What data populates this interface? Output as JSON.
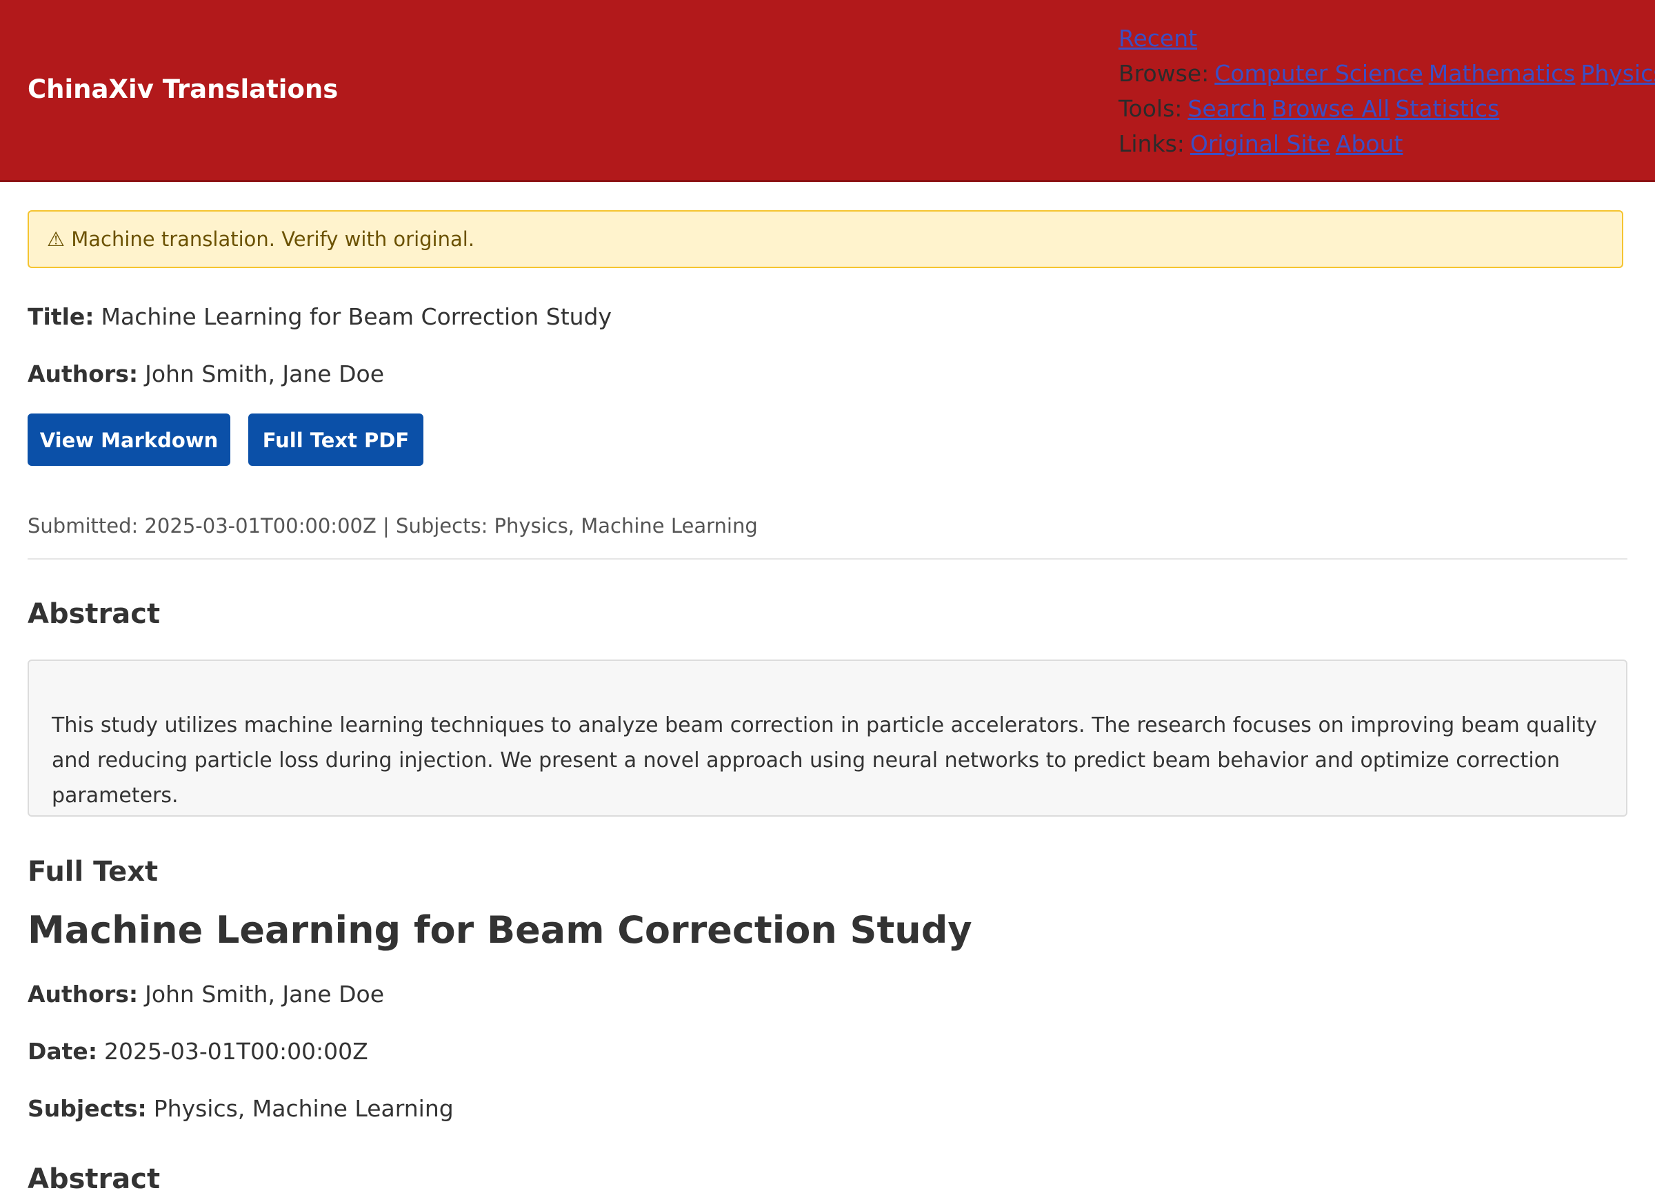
{
  "header": {
    "brand": "ChinaXiv Translations",
    "nav": {
      "recent": "Recent",
      "browse_label": "Browse:",
      "browse_links": [
        "Computer Science",
        "Mathematics",
        "Physics"
      ],
      "tools_label": "Tools:",
      "tools_links": [
        "Search",
        "Browse All",
        "Statistics"
      ],
      "links_label": "Links:",
      "links_links": [
        "Original Site",
        "About"
      ]
    }
  },
  "warning": "⚠ Machine translation. Verify with original.",
  "paper": {
    "title_label": "Title:",
    "title": "Machine Learning for Beam Correction Study",
    "authors_label": "Authors:",
    "authors": "John Smith, Jane Doe",
    "buttons": {
      "markdown": "View Markdown",
      "pdf": "Full Text PDF"
    },
    "meta": "Submitted: 2025-03-01T00:00:00Z | Subjects: Physics, Machine Learning",
    "abstract_heading": "Abstract",
    "abstract": "This study utilizes machine learning techniques to analyze beam correction in particle accelerators. The research focuses on improving beam quality and reducing particle loss during injection. We present a novel approach using neural networks to predict beam behavior and optimize correction parameters."
  },
  "fulltext": {
    "heading": "Full Text",
    "title": "Machine Learning for Beam Correction Study",
    "authors_label": "Authors:",
    "authors": "John Smith, Jane Doe",
    "date_label": "Date:",
    "date": "2025-03-01T00:00:00Z",
    "subjects_label": "Subjects:",
    "subjects": "Physics, Machine Learning",
    "abstract_heading": "Abstract"
  },
  "colors": {
    "header_bg": "#b2191b",
    "button_bg": "#0b50a8",
    "warning_bg": "#fff3cd",
    "link": "#3b4fc4"
  }
}
